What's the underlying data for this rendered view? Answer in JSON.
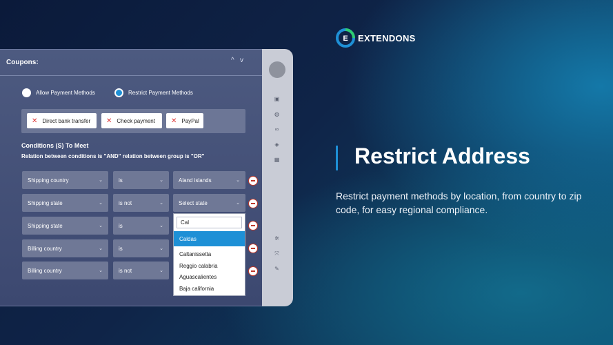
{
  "panel": {
    "title": "Coupons:",
    "collapse_icon": "^",
    "expand_icon": "v"
  },
  "payment_mode": {
    "options": [
      "Allow Payment Methods",
      "Restrict Payment Methods"
    ],
    "selected": "Restrict Payment Methods"
  },
  "methods": [
    "Direct bank transfer",
    "Check payment",
    "PayPal"
  ],
  "conditions": {
    "title": "Conditions (S) To Meet",
    "relation": "Relation between conditions is \"AND\" relation between group is \"OR\"",
    "rows": [
      {
        "field": "Shipping country",
        "op": "is",
        "value": "Aland islands"
      },
      {
        "field": "Shipping state",
        "op": "is not",
        "value": "Select state"
      },
      {
        "field": "Shipping state",
        "op": "is",
        "value": ""
      },
      {
        "field": "Billing country",
        "op": "is",
        "value": ""
      },
      {
        "field": "Billing country",
        "op": "is not",
        "value": ""
      }
    ]
  },
  "dropdown": {
    "search": "Cal",
    "options": [
      "Caldas",
      "Caltanissetta",
      "Reggio calabria",
      "Aguascalientes",
      "Baja california"
    ],
    "highlighted": "Caldas"
  },
  "brand": {
    "name": "EXTENDONS",
    "logo_letter": "E"
  },
  "promo": {
    "heading": "Restrict Address",
    "description": "Restrict payment methods by location, from country to zip code, for easy regional compliance."
  },
  "colors": {
    "accent": "#1e90d6",
    "logo_green": "#2ecc71"
  },
  "icons": [
    "archive-icon",
    "globe-icon",
    "link-icon",
    "tag-icon",
    "grid-icon",
    "gear-icon",
    "expand-icon",
    "wrench-icon"
  ]
}
